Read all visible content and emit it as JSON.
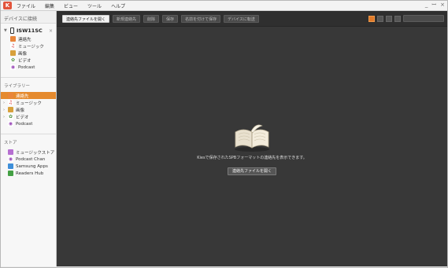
{
  "menubar": {
    "logo_text": "K",
    "items": [
      "ファイル",
      "編集",
      "ビュー",
      "ツール",
      "ヘルプ"
    ],
    "window_controls": [
      "_",
      "ꟷ",
      "×"
    ]
  },
  "sidebar": {
    "devices_title": "デバイスに接続",
    "device_name": "ISW11SC",
    "device_close": "×",
    "device_items": [
      {
        "label": "連絡先",
        "icon": "contacts-icon"
      },
      {
        "label": "ミュージック",
        "icon": "music-icon"
      },
      {
        "label": "画像",
        "icon": "photo-icon"
      },
      {
        "label": "ビデオ",
        "icon": "video-icon"
      },
      {
        "label": "Podcast",
        "icon": "podcast-icon"
      }
    ],
    "library_title": "ライブラリー",
    "library_items": [
      {
        "label": "連絡先",
        "icon": "contacts-icon",
        "selected": true
      },
      {
        "label": "ミュージック",
        "icon": "music-icon"
      },
      {
        "label": "画像",
        "icon": "photo-icon"
      },
      {
        "label": "ビデオ",
        "icon": "video-icon"
      },
      {
        "label": "Podcast",
        "icon": "podcast-icon"
      }
    ],
    "store_title": "ストア",
    "store_items": [
      {
        "label": "ミュージックストア",
        "icon": "store-icon"
      },
      {
        "label": "Podcast Chan",
        "icon": "podcast-icon"
      },
      {
        "label": "Samsung Apps",
        "icon": "apps-icon"
      },
      {
        "label": "Readers Hub",
        "icon": "hub-icon"
      }
    ]
  },
  "toolbar": {
    "open_contacts_file": "連絡先ファイルを開く",
    "new_contact": "新規連絡先",
    "delete": "削除",
    "save": "保存",
    "save_as": "名前を付けて保存",
    "transfer_to_device": "デバイスに転送",
    "search_placeholder": ""
  },
  "empty_state": {
    "message": "Kiesで保存されたSPBフォーマットの連絡先を表示できます。",
    "button_label": "連絡先ファイルを開く"
  },
  "colors": {
    "accent": "#e58a2e",
    "content_bg": "#383838",
    "toolbar_bg": "#2f2f2f"
  }
}
